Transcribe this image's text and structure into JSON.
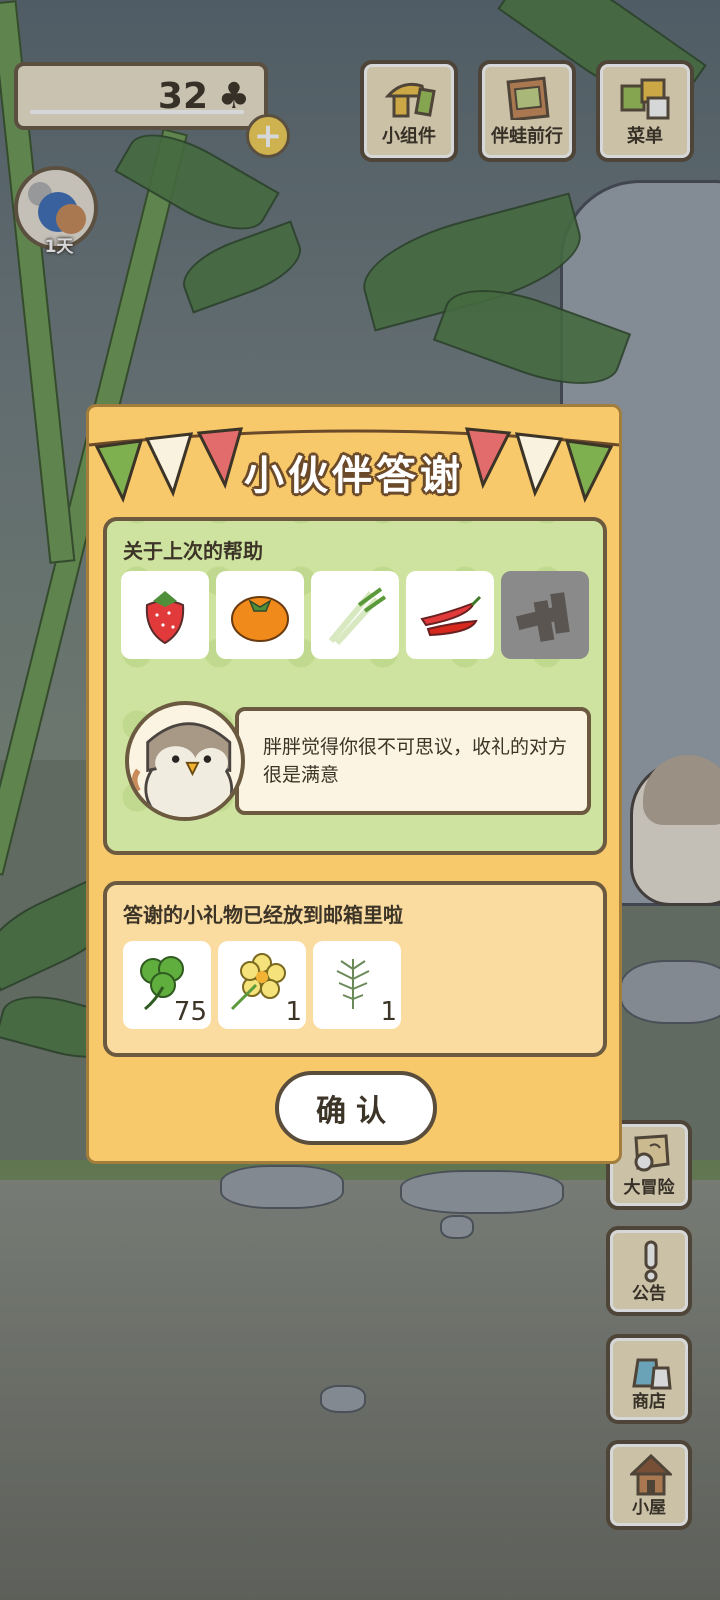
{
  "hud": {
    "clover_amount": "32",
    "clover_symbol": "♣",
    "plus_symbol": "+",
    "days_label": "1天"
  },
  "top_menu": [
    {
      "label": "小组件",
      "icon": "widget-icon"
    },
    {
      "label": "伴蛙前行",
      "icon": "journey-book-icon"
    },
    {
      "label": "菜单",
      "icon": "menu-cards-icon"
    }
  ],
  "side_menu": [
    {
      "label": "大冒险",
      "icon": "adventure-map-icon"
    },
    {
      "label": "公告",
      "icon": "exclamation-icon"
    },
    {
      "label": "商店",
      "icon": "shop-bags-icon"
    },
    {
      "label": "小屋",
      "icon": "house-icon"
    }
  ],
  "dialog": {
    "title": "小伙伴答谢",
    "help_section_title": "关于上次的帮助",
    "help_items": [
      {
        "icon": "strawberry-icon",
        "disabled": false
      },
      {
        "icon": "persimmon-icon",
        "disabled": false
      },
      {
        "icon": "green-onion-icon",
        "disabled": false
      },
      {
        "icon": "chili-pepper-icon",
        "disabled": false
      },
      {
        "icon": "bread-crust-icon",
        "disabled": true
      }
    ],
    "message": "胖胖觉得你很不可思议，收礼的对方很是满意",
    "gift_section_title": "答谢的小礼物已经放到邮箱里啦",
    "gifts": [
      {
        "icon": "clover-icon",
        "count": "75"
      },
      {
        "icon": "yellow-flower-icon",
        "count": "1"
      },
      {
        "icon": "herb-sprig-icon",
        "count": "1"
      }
    ],
    "confirm_label": "确认"
  },
  "colors": {
    "dialog_bg": "#f7c96a",
    "panel_green": "#cfe3a0",
    "panel_gift": "#fbdca0",
    "outline": "#6b5a40"
  }
}
